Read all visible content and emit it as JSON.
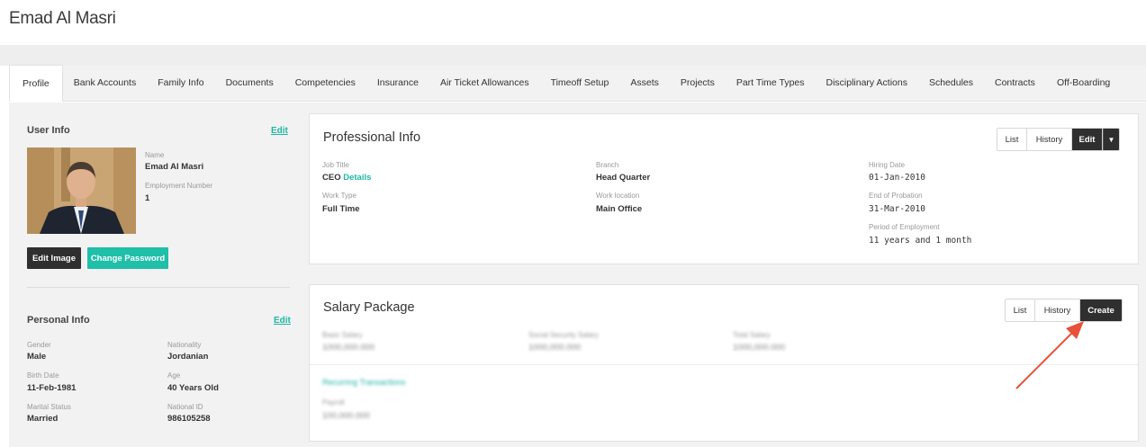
{
  "page": {
    "title": "Emad Al Masri"
  },
  "tabs": [
    {
      "label": "Profile",
      "active": true
    },
    {
      "label": "Bank Accounts"
    },
    {
      "label": "Family Info"
    },
    {
      "label": "Documents"
    },
    {
      "label": "Competencies"
    },
    {
      "label": "Insurance"
    },
    {
      "label": "Air Ticket Allowances"
    },
    {
      "label": "Timeoff Setup"
    },
    {
      "label": "Assets"
    },
    {
      "label": "Projects"
    },
    {
      "label": "Part Time Types"
    },
    {
      "label": "Disciplinary Actions"
    },
    {
      "label": "Schedules"
    },
    {
      "label": "Contracts"
    },
    {
      "label": "Off-Boarding"
    }
  ],
  "user_info": {
    "heading": "User Info",
    "edit_label": "Edit",
    "name_label": "Name",
    "name_value": "Emad Al Masri",
    "employment_number_label": "Employment Number",
    "employment_number_value": "1",
    "edit_image_label": "Edit Image",
    "change_password_label": "Change Password"
  },
  "personal_info": {
    "heading": "Personal Info",
    "edit_label": "Edit",
    "gender_label": "Gender",
    "gender_value": "Male",
    "nationality_label": "Nationality",
    "nationality_value": "Jordanian",
    "birth_date_label": "Birth Date",
    "birth_date_value": "11-Feb-1981",
    "age_label": "Age",
    "age_value": "40 Years Old",
    "marital_status_label": "Marital Status",
    "marital_status_value": "Married",
    "national_id_label": "National ID",
    "national_id_value": "986105258"
  },
  "professional_info": {
    "title": "Professional Info",
    "list_label": "List",
    "history_label": "History",
    "edit_label": "Edit",
    "job_title_label": "Job Title",
    "job_title_value": "CEO",
    "details_link": "Details",
    "work_type_label": "Work Type",
    "work_type_value": "Full Time",
    "branch_label": "Branch",
    "branch_value": "Head Quarter",
    "work_location_label": "Work location",
    "work_location_value": "Main Office",
    "hiring_date_label": "Hiring Date",
    "hiring_date_value": "01-Jan-2010",
    "end_of_probation_label": "End of Probation",
    "end_of_probation_value": "31-Mar-2010",
    "period_label": "Period of Employment",
    "period_value": "11 years and 1 month"
  },
  "salary_package": {
    "title": "Salary Package",
    "list_label": "List",
    "history_label": "History",
    "create_label": "Create",
    "basic_salary_label": "Basic Salary",
    "basic_salary_value": "1000,000.000",
    "social_security_label": "Social Security Salary",
    "social_security_value": "1000,000.000",
    "total_salary_label": "Total Salary",
    "total_salary_value": "1000,000.000",
    "recurring_link": "Recurring Transactions",
    "payroll_label": "Payroll",
    "payroll_value": "100,000.000"
  },
  "colors": {
    "accent_teal": "#1fbfa8",
    "dark_button": "#2f2f2f",
    "annotation_arrow": "#e8503a"
  }
}
